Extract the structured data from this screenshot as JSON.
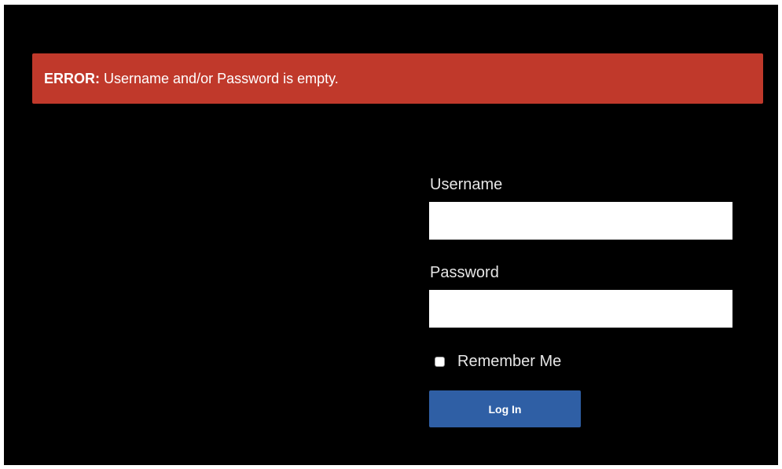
{
  "error": {
    "prefix": "ERROR:",
    "message": " Username and/or Password is empty."
  },
  "form": {
    "username_label": "Username",
    "username_value": "",
    "password_label": "Password",
    "password_value": "",
    "remember_label": "Remember Me",
    "remember_checked": false,
    "login_button_label": "Log In"
  },
  "colors": {
    "background": "#000000",
    "error_banner": "#c0392b",
    "login_button": "#2f5fa5",
    "label_text": "#e6e6e6"
  }
}
